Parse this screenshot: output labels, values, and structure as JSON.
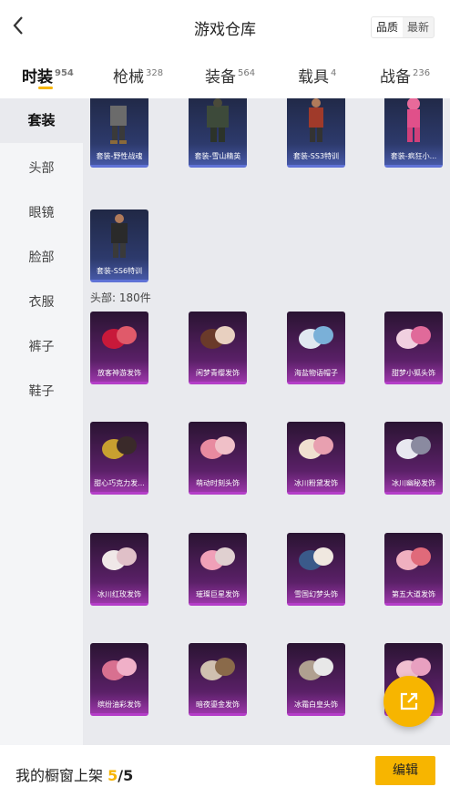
{
  "header": {
    "title": "游戏仓库",
    "sort_options": [
      "品质",
      "最新"
    ]
  },
  "tabs": [
    {
      "label": "时装",
      "count": "954"
    },
    {
      "label": "枪械",
      "count": "328"
    },
    {
      "label": "装备",
      "count": "564"
    },
    {
      "label": "载具",
      "count": "4"
    },
    {
      "label": "战备",
      "count": "236"
    }
  ],
  "sidebar": {
    "items": [
      "套装",
      "头部",
      "眼镜",
      "脸部",
      "衣服",
      "裤子",
      "鞋子"
    ]
  },
  "outfits": [
    "套装-野性战魂",
    "套装-雪山精英",
    "套装-SS3特训",
    "套装-疯狂小...",
    "套装-SS6特训"
  ],
  "head_section": {
    "label": "头部: 180件"
  },
  "head_items": [
    "放客神游发饰",
    "闲梦青缨发饰",
    "海盐物语帽子",
    "甜梦小狐头饰",
    "甜心巧克力发...",
    "萌动时刻头饰",
    "冰川粉黛发饰",
    "冰川幽秘发饰",
    "冰川红玫发饰",
    "璀璨巨星发饰",
    "雪国幻梦头饰",
    "第五大道发饰",
    "缤纷油彩发饰",
    "暗夜鎏金发饰",
    "冰霜白皇头饰",
    ""
  ],
  "bottom": {
    "label": "我的橱窗上架",
    "shown": "5",
    "total": "/5",
    "edit_label": "编辑"
  },
  "colors": {
    "accent": "#f7b500",
    "outfit_card": "#2d3a6c",
    "head_card": "#9a36a8"
  }
}
